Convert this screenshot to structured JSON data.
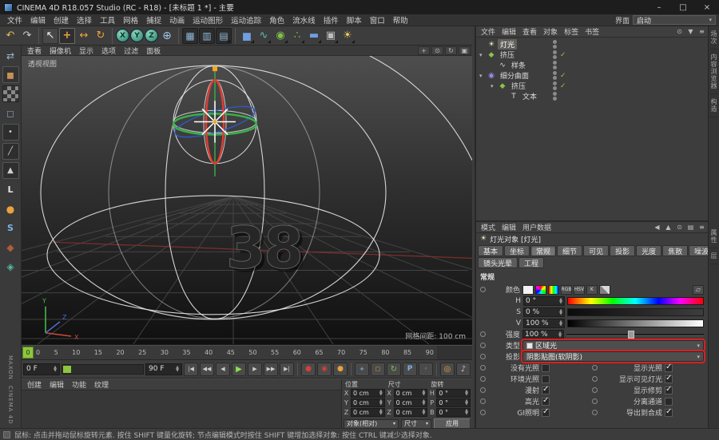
{
  "titlebar": {
    "title": "CINEMA 4D R18.057 Studio (RC - R18) - [未标题 1 *] - 主要",
    "minimize": "–",
    "maximize": "□",
    "close": "×"
  },
  "menubar": {
    "items": [
      "文件",
      "编辑",
      "创建",
      "选择",
      "工具",
      "网格",
      "捕捉",
      "动画",
      "运动图形",
      "运动追踪",
      "角色",
      "流水线",
      "插件",
      "脚本",
      "窗口",
      "帮助"
    ],
    "interface_label": "界面",
    "layout_value": "启动"
  },
  "toolbar": {
    "history": [
      {
        "name": "undo-button",
        "glyph": "↶"
      },
      {
        "name": "redo-button",
        "glyph": "↷"
      }
    ],
    "tools": [
      {
        "name": "live-selection-tool",
        "glyph": "↖"
      },
      {
        "name": "move-tool",
        "glyph": "+"
      },
      {
        "name": "scale-tool",
        "glyph": "↔"
      },
      {
        "name": "rotate-tool",
        "glyph": "↻"
      }
    ],
    "axis": [
      {
        "name": "axis-x-button",
        "glyph": "X"
      },
      {
        "name": "axis-y-button",
        "glyph": "Y"
      },
      {
        "name": "axis-z-button",
        "glyph": "Z"
      },
      {
        "name": "coord-system-button",
        "glyph": "⊕"
      }
    ],
    "render": [
      {
        "name": "render-view-button",
        "glyph": "▦"
      },
      {
        "name": "render-picture-button",
        "glyph": "▥"
      },
      {
        "name": "render-settings-button",
        "glyph": "▤",
        "more": true
      }
    ],
    "create": [
      {
        "name": "add-cube-button",
        "glyph": "◼",
        "more": true
      },
      {
        "name": "spline-pen-button",
        "glyph": "∿",
        "more": true
      },
      {
        "name": "subdivision-button",
        "glyph": "◉",
        "more": true
      },
      {
        "name": "array-button",
        "glyph": "∴",
        "more": true
      },
      {
        "name": "floor-button",
        "glyph": "▬",
        "more": true
      },
      {
        "name": "camera-button",
        "glyph": "▣",
        "more": true
      },
      {
        "name": "light-button",
        "glyph": "☀",
        "more": true
      }
    ]
  },
  "leftstrip": {
    "items": [
      {
        "name": "make-editable-button",
        "glyph": "⇄"
      },
      {
        "name": "model-mode-button",
        "glyph": "◼"
      },
      {
        "name": "texture-mode-button",
        "glyph": "▦"
      },
      {
        "name": "workplane-mode-button",
        "glyph": "◻"
      },
      {
        "name": "points-mode-button",
        "glyph": "•"
      },
      {
        "name": "edges-mode-button",
        "glyph": "╱"
      },
      {
        "name": "polygons-mode-button",
        "glyph": "▲"
      },
      {
        "name": "enable-axis-button",
        "glyph": "L"
      },
      {
        "name": "lock-axis-button",
        "glyph": "●"
      },
      {
        "name": "snap-button",
        "glyph": "S"
      },
      {
        "name": "paint-tool-button",
        "glyph": "◆"
      },
      {
        "name": "viewport-solo-button",
        "glyph": "◈"
      }
    ],
    "brand1": "MAXON",
    "brand2": "CINEMA 4D"
  },
  "viewport": {
    "menus": [
      "查看",
      "摄像机",
      "显示",
      "选项",
      "过滤",
      "面板"
    ],
    "nav": [
      {
        "name": "pan-view-icon",
        "glyph": "+"
      },
      {
        "name": "zoom-view-icon",
        "glyph": "⊙"
      },
      {
        "name": "rotate-view-icon",
        "glyph": "↻"
      },
      {
        "name": "toggle-view-icon",
        "glyph": "▣"
      }
    ],
    "view_label": "透视视图",
    "grid_label": "网格间距: 100 cm",
    "object_text": "38"
  },
  "timeline": {
    "current": "0",
    "ticks": [
      "0",
      "5",
      "10",
      "15",
      "20",
      "25",
      "30",
      "35",
      "40",
      "45",
      "50",
      "55",
      "60",
      "65",
      "70",
      "75",
      "80",
      "85",
      "90"
    ],
    "start": "0 F",
    "end": "90 F",
    "transport": [
      {
        "name": "goto-start-button",
        "glyph": "|◀"
      },
      {
        "name": "prev-key-button",
        "glyph": "◀◀"
      },
      {
        "name": "prev-frame-button",
        "glyph": "◀"
      },
      {
        "name": "play-button",
        "glyph": "▶"
      },
      {
        "name": "next-frame-button",
        "glyph": "▶"
      },
      {
        "name": "next-key-button",
        "glyph": "▶▶"
      },
      {
        "name": "goto-end-button",
        "glyph": "▶|"
      }
    ],
    "record": [
      {
        "name": "record-keyframe-button",
        "glyph": "●"
      },
      {
        "name": "autokey-button",
        "glyph": "◉"
      },
      {
        "name": "keyframe-selection-button",
        "glyph": "●"
      }
    ],
    "keys": [
      {
        "name": "record-position-button",
        "glyph": "+"
      },
      {
        "name": "record-scale-button",
        "glyph": "▢"
      },
      {
        "name": "record-rotation-button",
        "glyph": "↻"
      },
      {
        "name": "record-parameter-button",
        "glyph": "P"
      },
      {
        "name": "record-pla-button",
        "glyph": "◦"
      }
    ],
    "extras": [
      {
        "name": "solo-button",
        "glyph": "◎"
      },
      {
        "name": "sound-button",
        "glyph": "♪"
      }
    ]
  },
  "material_manager": {
    "menus": [
      "创建",
      "编辑",
      "功能",
      "纹理"
    ]
  },
  "coordinates": {
    "pos": {
      "title": "位置",
      "rows": [
        {
          "axis": "X",
          "value": "0 cm"
        },
        {
          "axis": "Y",
          "value": "0 cm"
        },
        {
          "axis": "Z",
          "value": "0 cm"
        }
      ]
    },
    "size": {
      "title": "尺寸",
      "rows": [
        {
          "axis": "X",
          "value": "0 cm"
        },
        {
          "axis": "Y",
          "value": "0 cm"
        },
        {
          "axis": "Z",
          "value": "0 cm"
        }
      ]
    },
    "rot": {
      "title": "旋转",
      "rows": [
        {
          "axis": "H",
          "value": "0 °"
        },
        {
          "axis": "P",
          "value": "0 °"
        },
        {
          "axis": "B",
          "value": "0 °"
        }
      ]
    },
    "mode_value": "对象(相对)",
    "size_mode_value": "尺寸",
    "apply_label": "应用"
  },
  "object_manager": {
    "menus": [
      "文件",
      "编辑",
      "查看",
      "对象",
      "标签",
      "书签"
    ],
    "icons": [
      {
        "name": "search-icon",
        "glyph": "⊙"
      },
      {
        "name": "filter-icon",
        "glyph": "▼"
      },
      {
        "name": "menu-icon",
        "glyph": "≡"
      }
    ],
    "objects": [
      {
        "name": "灯光",
        "icon": "light",
        "icon_glyph": "☀",
        "depth": 0,
        "selected": true,
        "expand": false,
        "check": false
      },
      {
        "name": "挤压",
        "icon": "extrude",
        "icon_glyph": "◆",
        "depth": 0,
        "expand": true,
        "check": true
      },
      {
        "name": "样条",
        "icon": "spline",
        "icon_glyph": "∿",
        "depth": 1,
        "expand": false,
        "check": false
      },
      {
        "name": "细分曲面",
        "icon": "sds",
        "icon_glyph": "◉",
        "depth": 0,
        "expand": true,
        "check": true
      },
      {
        "name": "挤压",
        "icon": "extrude",
        "icon_glyph": "◆",
        "depth": 1,
        "expand": true,
        "check": true
      },
      {
        "name": "文本",
        "icon": "text",
        "icon_glyph": "T",
        "depth": 2,
        "expand": false,
        "check": false
      }
    ]
  },
  "attributes": {
    "menus": [
      "模式",
      "编辑",
      "用户数据"
    ],
    "icons": [
      {
        "name": "back-icon",
        "glyph": "◀"
      },
      {
        "name": "up-icon",
        "glyph": "▲"
      },
      {
        "name": "search-icon",
        "glyph": "⊙"
      },
      {
        "name": "pin-icon",
        "glyph": "▤"
      },
      {
        "name": "menu-icon",
        "glyph": "≡"
      }
    ],
    "title_icon": "☀",
    "title": "灯光对象 [灯光]",
    "tabs1": [
      {
        "label": "基本"
      },
      {
        "label": "坐标"
      },
      {
        "label": "常规",
        "active": true
      },
      {
        "label": "细节"
      },
      {
        "label": "可见"
      },
      {
        "label": "投影"
      },
      {
        "label": "光度"
      },
      {
        "label": "焦散"
      },
      {
        "label": "噪波"
      }
    ],
    "tabs2": [
      {
        "label": "镜头光晕"
      },
      {
        "label": "工程"
      }
    ],
    "section": "常规",
    "color_label": "颜色",
    "color_buttons": [
      {
        "name": "color-swatch-button",
        "glyph": ""
      },
      {
        "name": "color-wheel-icon",
        "glyph": ""
      },
      {
        "name": "color-spectrum-icon",
        "glyph": ""
      },
      {
        "name": "rgb-button",
        "glyph": "RGB"
      },
      {
        "name": "hsv-button",
        "glyph": "HSV"
      },
      {
        "name": "kelvin-button",
        "glyph": "K"
      },
      {
        "name": "color-mixer-icon",
        "glyph": ""
      },
      {
        "name": "color-picker-icon",
        "glyph": "▱"
      }
    ],
    "hsv": [
      {
        "label": "H",
        "value": "0 °",
        "bar": "hue"
      },
      {
        "label": "S",
        "value": "0 %",
        "bar": "sat"
      },
      {
        "label": "V",
        "value": "100 %",
        "bar": "val"
      }
    ],
    "intensity": {
      "label": "强度",
      "value": "100 %"
    },
    "type": {
      "label": "类型",
      "value": "区域光"
    },
    "shadow": {
      "label": "投影",
      "value": "阴影贴图(软阴影)"
    },
    "options": [
      {
        "left": {
          "label": "没有光照",
          "checked": false
        },
        "right": {
          "label": "显示光照",
          "checked": true
        }
      },
      {
        "left": {
          "label": "环境光照",
          "checked": false
        },
        "right": {
          "label": "显示可见灯光",
          "checked": true
        }
      },
      {
        "left": {
          "label": "漫射",
          "checked": true
        },
        "right": {
          "label": "显示修剪",
          "checked": true
        }
      },
      {
        "left": {
          "label": "高光",
          "checked": true
        },
        "right": {
          "label": "分离通道",
          "checked": false
        }
      },
      {
        "left": {
          "label": "GI照明",
          "checked": true
        },
        "right": {
          "label": "导出到合成",
          "checked": true
        }
      }
    ]
  },
  "right_tabs": {
    "top": [
      "场次",
      "内容浏览器",
      "构造"
    ],
    "bottom": [
      "属性",
      "层"
    ]
  },
  "statusbar": {
    "text": "鼠标: 点击并拖动鼠标旋转元素. 按住 SHIFT 键量化旋转; 节点编辑模式时按住 SHIFT 键增加选择对象: 按住 CTRL 键减少选择对象."
  }
}
